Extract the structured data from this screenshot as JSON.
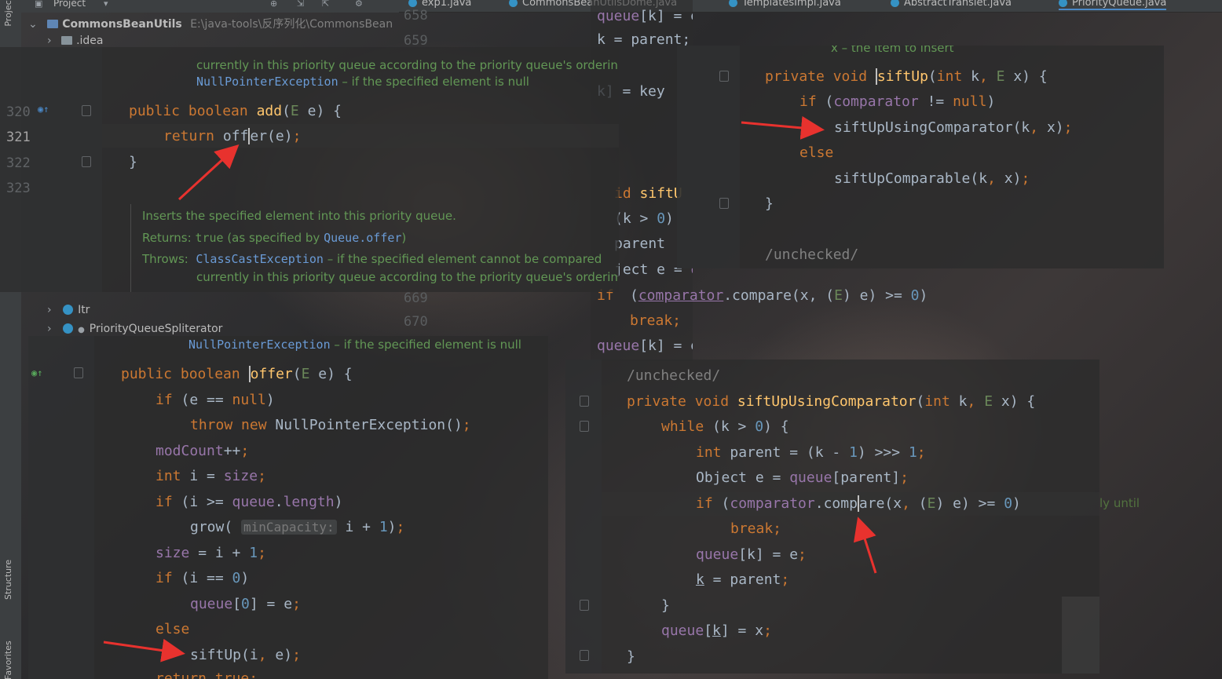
{
  "project": {
    "panel_label": "Project",
    "root_name": "CommonsBeanUtils",
    "root_path": "E:\\java-tools\\反序列化\\CommonsBean",
    "idea_folder": ".idea",
    "items": [
      "Itr",
      "PriorityQueueSpliterator"
    ]
  },
  "tabs": [
    {
      "label": "exp1.java"
    },
    {
      "label": "CommonsBeanUtilsDome.java"
    },
    {
      "label": "TemplatesImpl.java"
    },
    {
      "label": "AbstractTranslet.java"
    },
    {
      "label": "PriorityQueue.java",
      "active": true
    }
  ],
  "side_labels": {
    "structure": "Structure",
    "favorites": "Favorites",
    "project": "Project"
  },
  "panel_add": {
    "top_doc_1": "currently in this priority queue according to the priority queue's orderin",
    "top_doc_2_code": "NullPointerException",
    "top_doc_2_text": " – if the specified element is null",
    "line_numbers": [
      "320",
      "321",
      "322",
      "323"
    ],
    "doc_inserts": "Inserts the specified element into this priority queue.",
    "doc_returns_label": "Returns:",
    "doc_returns_code": "true",
    "doc_returns_mid": " (as specified by ",
    "doc_returns_link": "Queue.offer",
    "doc_returns_end": ")",
    "doc_throws_label": "Throws:",
    "doc_throws_code": "ClassCastException",
    "doc_throws_text": " – if the specified element cannot be compared",
    "doc_throws_cont": "currently in this priority queue according to the priority queue's orderin"
  },
  "panel_offer": {
    "doc_code": "NullPointerException",
    "doc_text": " – if the specified element is null",
    "hint": "minCapacity:"
  },
  "panel_siftup": {
    "doc_top": "x – the item to insert",
    "annotation": "/unchecked/"
  },
  "panel_comparator": {
    "annotation": "/unchecked/"
  },
  "background_code": {
    "line_numbers": [
      "658",
      "659",
      "669",
      "670"
    ],
    "misc": [
      "ly until"
    ]
  },
  "colors": {
    "keyword": "#cc7832",
    "method": "#ffc66d",
    "field": "#9876aa",
    "number": "#6897bb",
    "doc": "#629755",
    "arrow": "#e8322e"
  }
}
